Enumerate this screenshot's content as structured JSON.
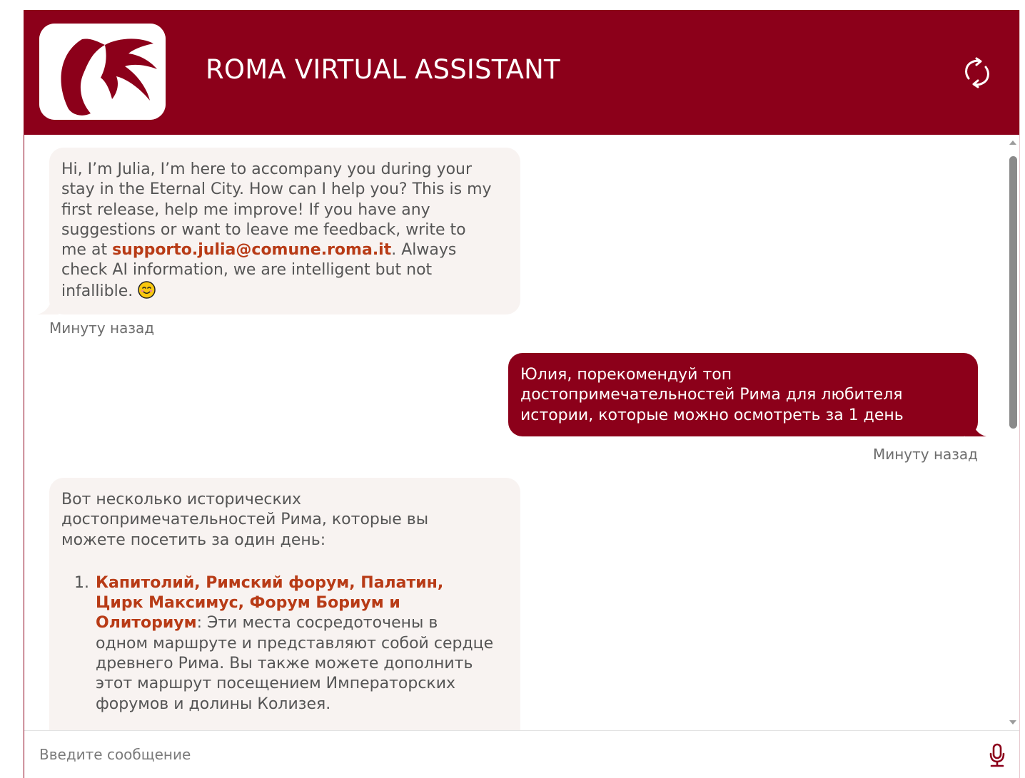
{
  "header": {
    "title": "ROMA VIRTUAL ASSISTANT",
    "logo_icon": "julia-logo-icon",
    "refresh_icon": "refresh-icon"
  },
  "colors": {
    "brand": "#8c001a",
    "bot_bubble_bg": "#f8f3f1",
    "highlight": "#b83b16"
  },
  "messages": [
    {
      "sender": "bot",
      "text_before_email": "Hi, I’m Julia, I’m here to accompany you during your stay in the Eternal City. How can I help you? This is my first release, help me improve! If you have any suggestions or want to leave me feedback, write to me at ",
      "email": "supporto.julia@comune.roma.it",
      "text_after_email": ". Always check AI information, we are intelligent but not infallible. ",
      "emoji": "smiling-face-emoji",
      "timestamp": "Минуту назад"
    },
    {
      "sender": "user",
      "text": "Юлия, порекомендуй топ достопримечательностей Рима для любителя истории, которые можно осмотреть за 1 день",
      "timestamp": "Минуту назад"
    },
    {
      "sender": "bot",
      "intro": "Вот несколько исторических достопримечательностей Рима, которые вы можете посетить за один день:",
      "list": [
        {
          "title": "Капитолий, Римский форум, Палатин, Цирк Максимус, Форум Бориум и Олиториум",
          "description": ": Эти места сосредоточены в одном маршруте и представляют собой сердце древнего Рима. Вы также можете дополнить этот маршрут посещением Императорских форумов и долины Колизея."
        }
      ]
    }
  ],
  "input": {
    "placeholder": "Введите сообщение",
    "value": "",
    "mic_icon": "microphone-icon"
  }
}
